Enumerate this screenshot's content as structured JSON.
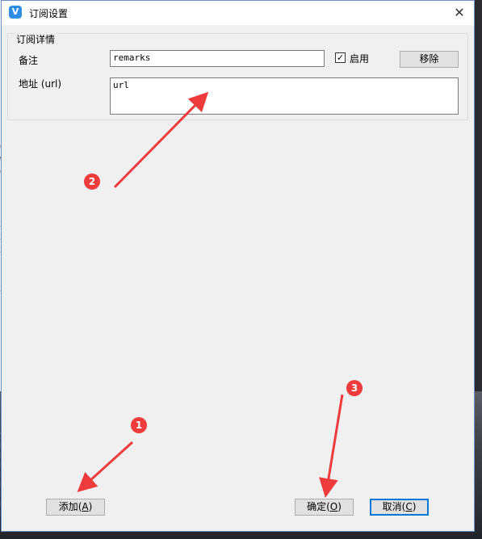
{
  "dialog": {
    "title": "订阅设置",
    "app_icon_glyph": "V",
    "close_glyph": "✕"
  },
  "group": {
    "legend": "订阅详情",
    "remark_label": "备注",
    "remark_value": "remarks",
    "enable_label": "启用",
    "enable_checked_glyph": "✓",
    "remove_label": "移除",
    "address_label": "地址 (url)",
    "address_value": "url"
  },
  "buttons": {
    "add_label": "添加",
    "add_hotkey": "A",
    "ok_label": "确定",
    "ok_hotkey": "O",
    "cancel_label": "取消",
    "cancel_hotkey": "C"
  },
  "annotations": {
    "marker_1": "1",
    "marker_2": "2",
    "marker_3": "3",
    "color": "#ee3b3b"
  },
  "background": {
    "chars_top": [
      "0",
      "%",
      "0"
    ],
    "chars_mid": [
      "3",
      "3",
      "3"
    ],
    "char_low": "3",
    "chars_bottom": [
      "y",
      "p",
      "p",
      "p",
      "p",
      "p",
      "p",
      "p",
      "p"
    ]
  }
}
